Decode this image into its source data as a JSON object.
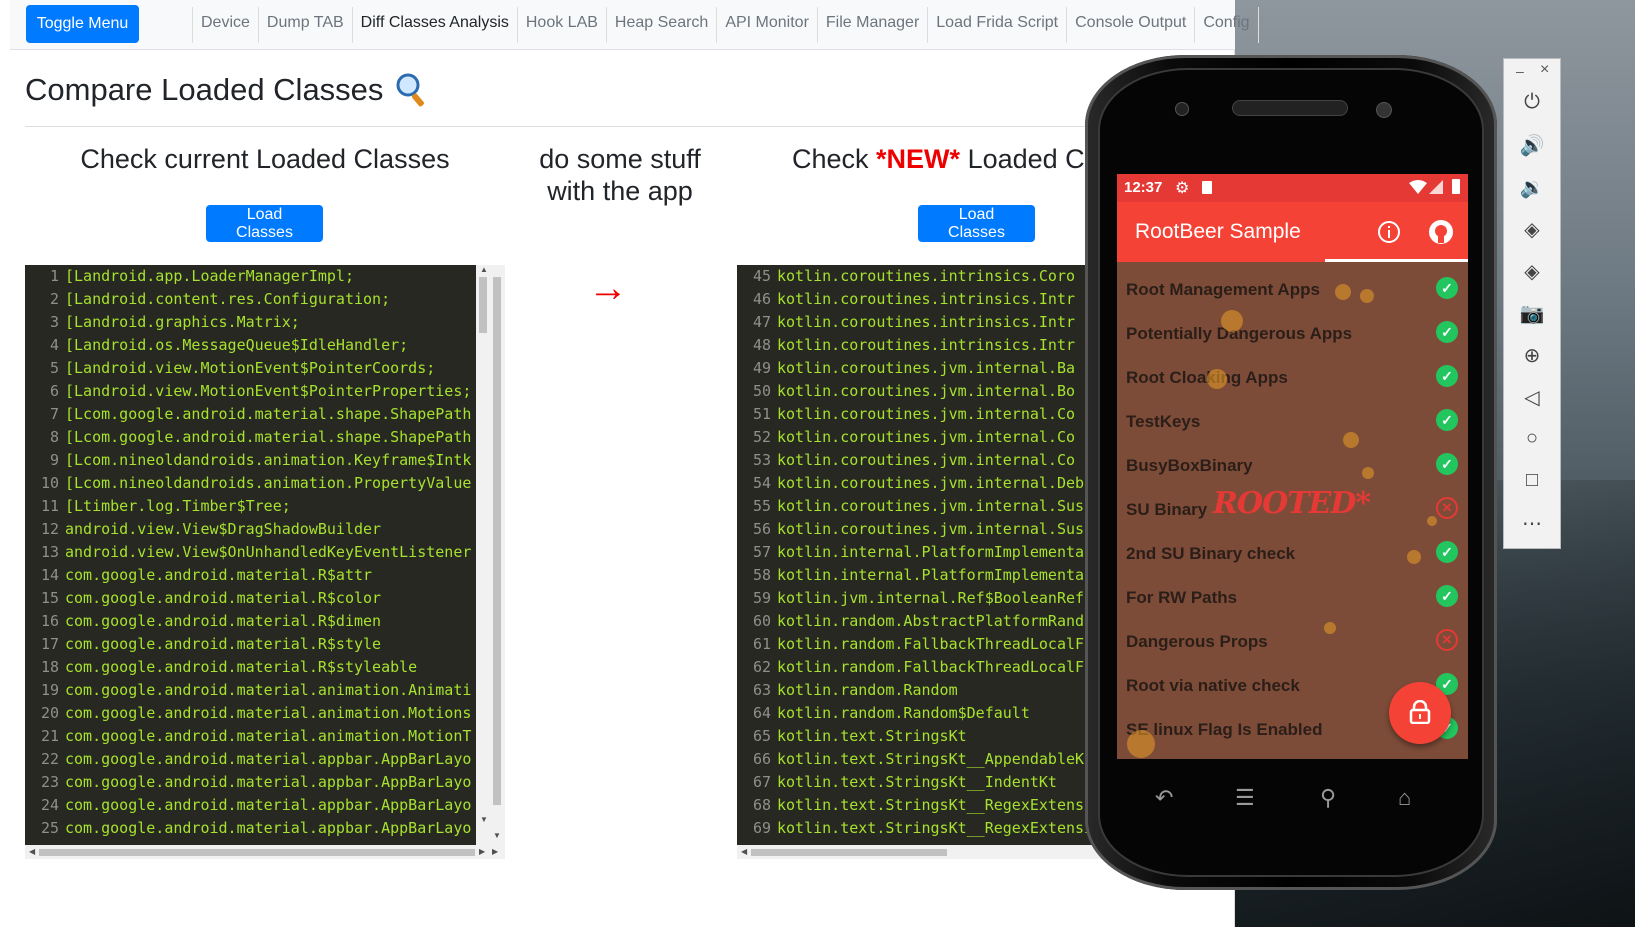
{
  "navbar": {
    "toggle_label": "Toggle Menu",
    "tabs": [
      "Device",
      "Dump TAB",
      "Diff Classes Analysis",
      "Hook LAB",
      "Heap Search",
      "API Monitor",
      "File Manager",
      "Load Frida Script",
      "Console Output",
      "Config"
    ],
    "active_tab": "Diff Classes Analysis"
  },
  "page": {
    "title": "Compare Loaded Classes",
    "title_icon": "magnifier-icon"
  },
  "left": {
    "heading": "Check current Loaded Classes",
    "button": "Load Classes",
    "lines": [
      {
        "n": "1",
        "t": "[Landroid.app.LoaderManagerImpl;"
      },
      {
        "n": "2",
        "t": "[Landroid.content.res.Configuration;"
      },
      {
        "n": "3",
        "t": "[Landroid.graphics.Matrix;"
      },
      {
        "n": "4",
        "t": "[Landroid.os.MessageQueue$IdleHandler;"
      },
      {
        "n": "5",
        "t": "[Landroid.view.MotionEvent$PointerCoords;"
      },
      {
        "n": "6",
        "t": "[Landroid.view.MotionEvent$PointerProperties;"
      },
      {
        "n": "7",
        "t": "[Lcom.google.android.material.shape.ShapePath"
      },
      {
        "n": "8",
        "t": "[Lcom.google.android.material.shape.ShapePath"
      },
      {
        "n": "9",
        "t": "[Lcom.nineoldandroids.animation.Keyframe$Intk"
      },
      {
        "n": "10",
        "t": "[Lcom.nineoldandroids.animation.PropertyValue"
      },
      {
        "n": "11",
        "t": "[Ltimber.log.Timber$Tree;"
      },
      {
        "n": "12",
        "t": "android.view.View$DragShadowBuilder"
      },
      {
        "n": "13",
        "t": "android.view.View$OnUnhandledKeyEventListener"
      },
      {
        "n": "14",
        "t": "com.google.android.material.R$attr"
      },
      {
        "n": "15",
        "t": "com.google.android.material.R$color"
      },
      {
        "n": "16",
        "t": "com.google.android.material.R$dimen"
      },
      {
        "n": "17",
        "t": "com.google.android.material.R$style"
      },
      {
        "n": "18",
        "t": "com.google.android.material.R$styleable"
      },
      {
        "n": "19",
        "t": "com.google.android.material.animation.Animati"
      },
      {
        "n": "20",
        "t": "com.google.android.material.animation.Motions"
      },
      {
        "n": "21",
        "t": "com.google.android.material.animation.MotionT"
      },
      {
        "n": "22",
        "t": "com.google.android.material.appbar.AppBarLayo"
      },
      {
        "n": "23",
        "t": "com.google.android.material.appbar.AppBarLayo"
      },
      {
        "n": "24",
        "t": "com.google.android.material.appbar.AppBarLayo"
      },
      {
        "n": "25",
        "t": "com.google.android.material.appbar.AppBarLayo"
      }
    ]
  },
  "middle": {
    "text": "do some stuff with the app",
    "arrow": "→"
  },
  "right": {
    "heading_pre": "Check ",
    "heading_new": "*NEW*",
    "heading_post": " Loaded Cl",
    "button": "Load Classes",
    "lines": [
      {
        "n": "45",
        "t": "kotlin.coroutines.intrinsics.Coro"
      },
      {
        "n": "46",
        "t": "kotlin.coroutines.intrinsics.Intr"
      },
      {
        "n": "47",
        "t": "kotlin.coroutines.intrinsics.Intr"
      },
      {
        "n": "48",
        "t": "kotlin.coroutines.intrinsics.Intr"
      },
      {
        "n": "49",
        "t": "kotlin.coroutines.jvm.internal.Ba"
      },
      {
        "n": "50",
        "t": "kotlin.coroutines.jvm.internal.Bo"
      },
      {
        "n": "51",
        "t": "kotlin.coroutines.jvm.internal.Co"
      },
      {
        "n": "52",
        "t": "kotlin.coroutines.jvm.internal.Co"
      },
      {
        "n": "53",
        "t": "kotlin.coroutines.jvm.internal.Co"
      },
      {
        "n": "54",
        "t": "kotlin.coroutines.jvm.internal.Deb"
      },
      {
        "n": "55",
        "t": "kotlin.coroutines.jvm.internal.Sus"
      },
      {
        "n": "56",
        "t": "kotlin.coroutines.jvm.internal.Sus"
      },
      {
        "n": "57",
        "t": "kotlin.internal.PlatformImplementa"
      },
      {
        "n": "58",
        "t": "kotlin.internal.PlatformImplementa"
      },
      {
        "n": "59",
        "t": "kotlin.jvm.internal.Ref$BooleanRef"
      },
      {
        "n": "60",
        "t": "kotlin.random.AbstractPlatformRand"
      },
      {
        "n": "61",
        "t": "kotlin.random.FallbackThreadLocalF"
      },
      {
        "n": "62",
        "t": "kotlin.random.FallbackThreadLocalF"
      },
      {
        "n": "63",
        "t": "kotlin.random.Random"
      },
      {
        "n": "64",
        "t": "kotlin.random.Random$Default"
      },
      {
        "n": "65",
        "t": "kotlin.text.StringsKt"
      },
      {
        "n": "66",
        "t": "kotlin.text.StringsKt__AppendableK"
      },
      {
        "n": "67",
        "t": "kotlin.text.StringsKt__IndentKt"
      },
      {
        "n": "68",
        "t": "kotlin.text.StringsKt__RegexExtens"
      },
      {
        "n": "69",
        "t": "kotlin.text.StringsKt__RegexExtensi"
      }
    ]
  },
  "phone": {
    "time": "12:37",
    "app_title": "RootBeer Sample",
    "checks": [
      {
        "label": "Root Management Apps",
        "ok": true
      },
      {
        "label": "Potentially Dangerous Apps",
        "ok": true
      },
      {
        "label": "Root Cloaking Apps",
        "ok": true
      },
      {
        "label": "TestKeys",
        "ok": true
      },
      {
        "label": "BusyBoxBinary",
        "ok": true
      },
      {
        "label": "SU Binary",
        "ok": false
      },
      {
        "label": "2nd SU Binary check",
        "ok": true
      },
      {
        "label": "For RW Paths",
        "ok": true
      },
      {
        "label": "Dangerous Props",
        "ok": false
      },
      {
        "label": "Root via native check",
        "ok": true
      },
      {
        "label": "SE linux Flag Is Enabled",
        "ok": true
      }
    ],
    "stamp": "ROOTED*"
  },
  "emulator": {
    "min": "–",
    "close": "×",
    "buttons": [
      "power-icon",
      "volume-up-icon",
      "volume-down-icon",
      "rotate-left-icon",
      "rotate-right-icon",
      "camera-icon",
      "zoom-icon",
      "back-icon",
      "home-icon",
      "overview-icon",
      "more-icon"
    ]
  }
}
